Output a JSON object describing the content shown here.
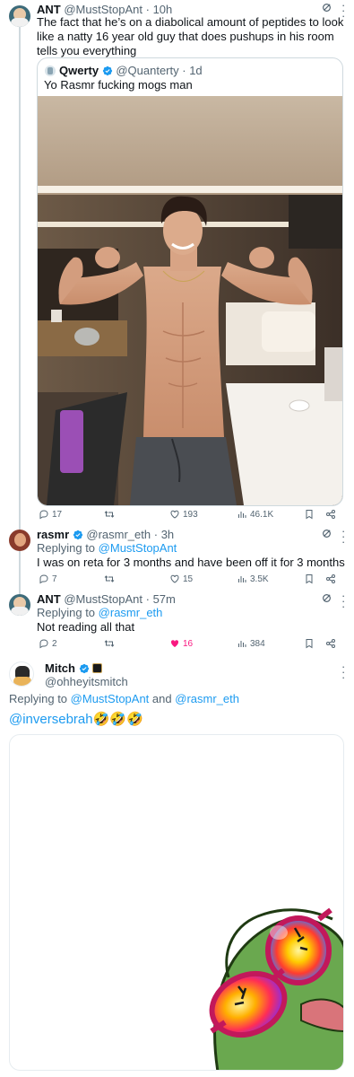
{
  "tweet1": {
    "name": "ANT",
    "handle": "@MustStopAnt",
    "time": "10h",
    "text": "The fact that he’s on a diabolical amount of peptides to look like a natty 16 year old guy that does pushups in his room tells you everything"
  },
  "quote": {
    "name": "Qwerty",
    "handle": "@Quanterty",
    "time": "1d",
    "text": "Yo Rasmr fucking mogs man",
    "image_icon": "photo-of-man-flexing"
  },
  "tweet1_actions": {
    "replies": "17",
    "retweets": "",
    "likes": "193",
    "views": "46.1K"
  },
  "tweet2": {
    "name": "rasmr",
    "handle": "@rasmr_eth",
    "time": "3h",
    "replying_prefix": "Replying to",
    "replying_to": "@MustStopAnt",
    "text": "I was on reta for 3 months and have been off it for 3 months"
  },
  "tweet2_actions": {
    "replies": "7",
    "retweets": "",
    "likes": "15",
    "views": "3.5K"
  },
  "tweet3": {
    "name": "ANT",
    "handle": "@MustStopAnt",
    "time": "57m",
    "replying_prefix": "Replying to",
    "replying_to": "@rasmr_eth",
    "text": "Not reading all that"
  },
  "tweet3_actions": {
    "replies": "2",
    "retweets": "",
    "likes": "16",
    "views": "384"
  },
  "tweet4": {
    "name": "Mitch",
    "handle": "@ohheyitsmitch",
    "replying_prefix": "Replying to",
    "replying_to_1": "@MustStopAnt",
    "replying_and": "and",
    "replying_to_2": "@rasmr_eth",
    "mention": "@inversebrah",
    "emojis": "🤣🤣🤣",
    "media_icon": "pepe-sunglasses-sticker"
  },
  "colors": {
    "accent": "#1d9bf0",
    "like_active": "#f91880",
    "text": "#0f1419",
    "muted": "#536471",
    "border": "#cfd9de"
  }
}
